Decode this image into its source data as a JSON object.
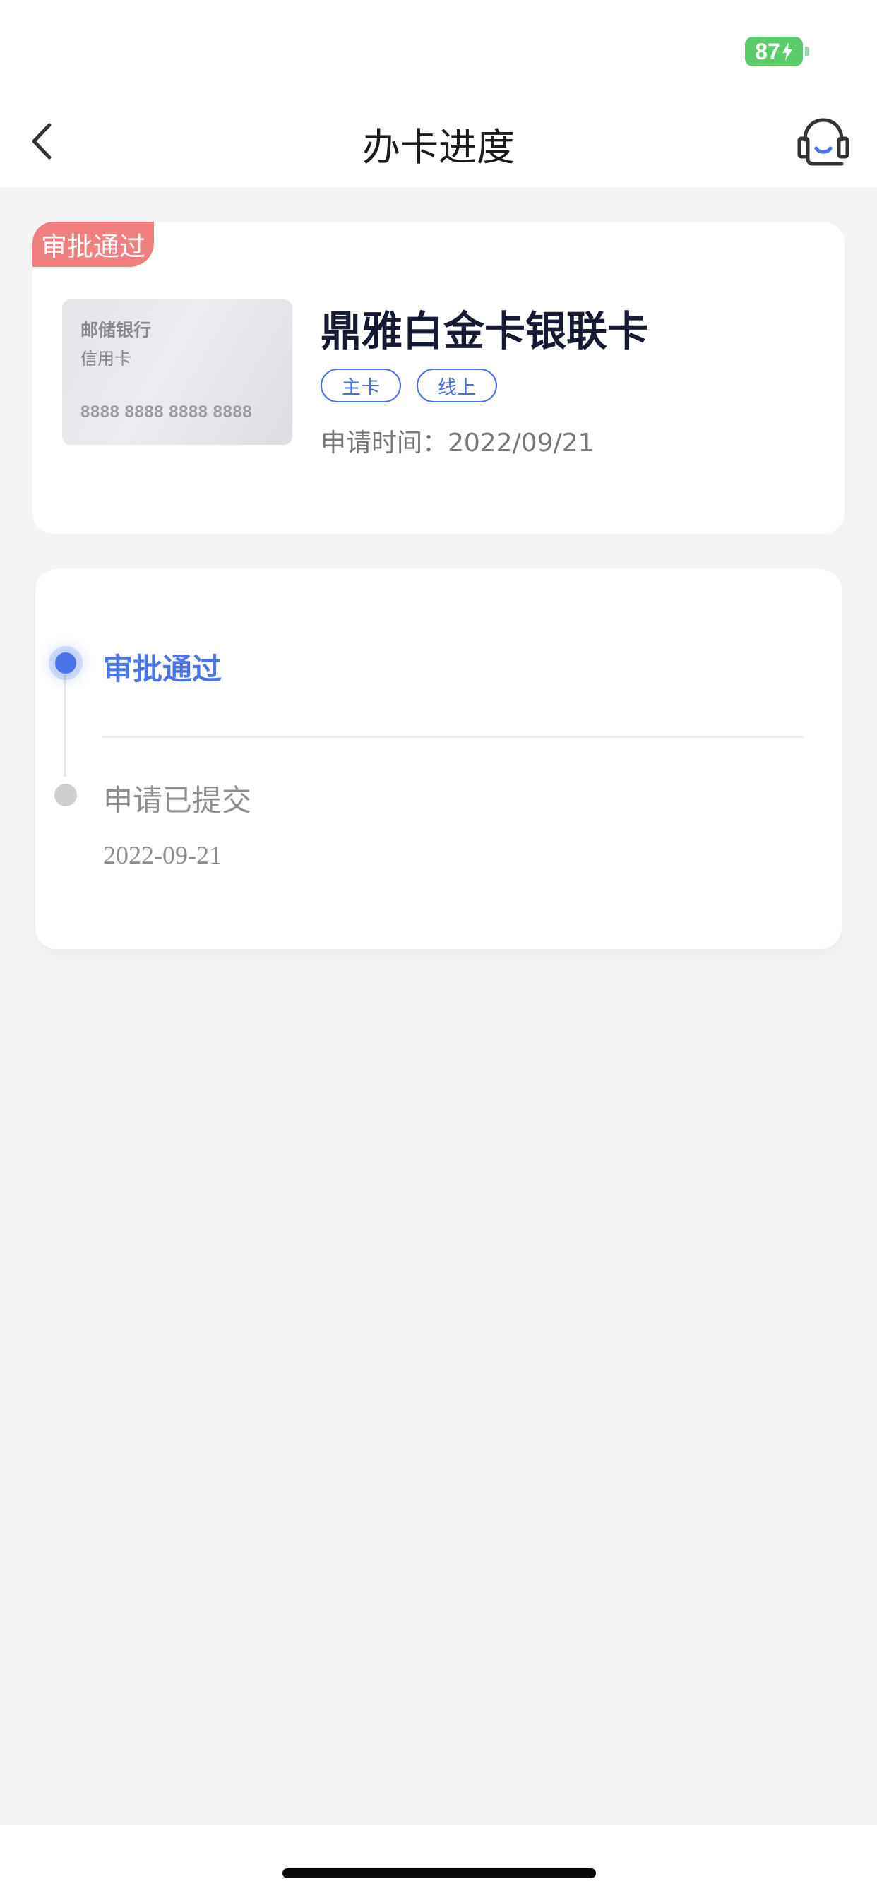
{
  "status_bar": {
    "battery_level": "87",
    "battery_color": "#5ccb6a",
    "battery_icon": "charging-bolt-icon"
  },
  "nav": {
    "title": "办卡进度",
    "back_icon": "chevron-left-icon",
    "service_icon": "headset-icon"
  },
  "card": {
    "status_tag": "审批通过",
    "image": {
      "bank": "邮储银行",
      "type": "信用卡",
      "number": "8888 8888 8888 8888"
    },
    "name": "鼎雅白金卡银联卡",
    "tags": [
      "主卡",
      "线上"
    ],
    "apply_time": "申请时间：2022/09/21"
  },
  "progress": {
    "steps": [
      {
        "title": "审批通过",
        "active": true
      },
      {
        "title": "申请已提交",
        "date": "2022-09-21",
        "active": false
      }
    ]
  },
  "colors": {
    "accent_blue": "#4a74e8",
    "status_tag_red": "#f08080",
    "page_background": "#f4f4f5"
  }
}
